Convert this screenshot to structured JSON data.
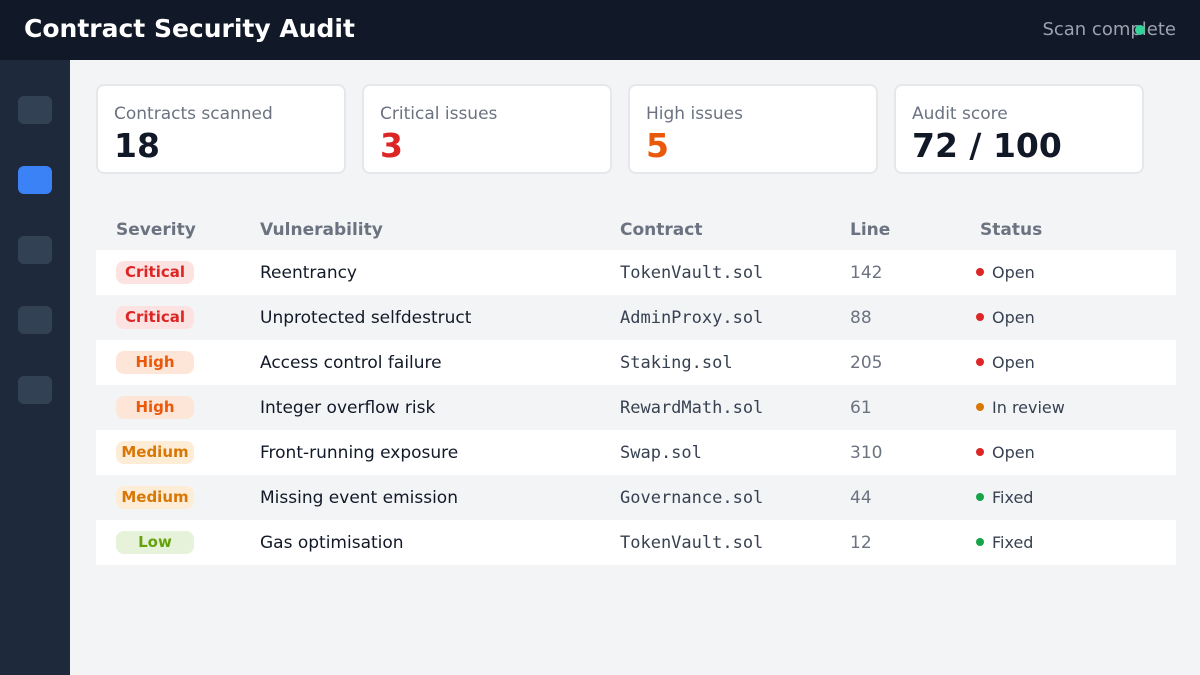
{
  "header": {
    "title": "Contract Security Audit",
    "scan_status": "Scan complete",
    "status_color": "#34d399"
  },
  "sidebar": {
    "items": [
      {
        "icon": "nav-icon-1",
        "active": false
      },
      {
        "icon": "nav-icon-2",
        "active": true
      },
      {
        "icon": "nav-icon-3",
        "active": false
      },
      {
        "icon": "nav-icon-4",
        "active": false
      },
      {
        "icon": "nav-icon-5",
        "active": false
      }
    ],
    "active_color": "#3b82f6"
  },
  "summary": [
    {
      "label": "Contracts scanned",
      "value": "18",
      "color": "#111827"
    },
    {
      "label": "Critical issues",
      "value": "3",
      "color": "#dc2626"
    },
    {
      "label": "High issues",
      "value": "5",
      "color": "#ea580c"
    },
    {
      "label": "Audit score",
      "value": "72 / 100",
      "color": "#111827"
    }
  ],
  "table": {
    "columns": [
      "Severity",
      "Vulnerability",
      "Contract",
      "Line",
      "Status"
    ],
    "rows": [
      {
        "severity": "Critical",
        "vulnerability": "Reentrancy",
        "contract": "TokenVault.sol",
        "line": "142",
        "status": "Open"
      },
      {
        "severity": "Critical",
        "vulnerability": "Unprotected selfdestruct",
        "contract": "AdminProxy.sol",
        "line": "88",
        "status": "Open"
      },
      {
        "severity": "High",
        "vulnerability": "Access control failure",
        "contract": "Staking.sol",
        "line": "205",
        "status": "Open"
      },
      {
        "severity": "High",
        "vulnerability": "Integer overflow risk",
        "contract": "RewardMath.sol",
        "line": "61",
        "status": "In review"
      },
      {
        "severity": "Medium",
        "vulnerability": "Front-running exposure",
        "contract": "Swap.sol",
        "line": "310",
        "status": "Open"
      },
      {
        "severity": "Medium",
        "vulnerability": "Missing event emission",
        "contract": "Governance.sol",
        "line": "44",
        "status": "Fixed"
      },
      {
        "severity": "Low",
        "vulnerability": "Gas optimisation",
        "contract": "TokenVault.sol",
        "line": "12",
        "status": "Fixed"
      }
    ]
  },
  "severity_colors": {
    "Critical": {
      "text": "#dc2626",
      "bg": "#fde2e2"
    },
    "High": {
      "text": "#ea580c",
      "bg": "#fde6d8"
    },
    "Medium": {
      "text": "#d97706",
      "bg": "#fdecd6"
    },
    "Low": {
      "text": "#65a30d",
      "bg": "#e6f2d9"
    }
  },
  "status_colors": {
    "Open": "#dc2626",
    "In review": "#d97706",
    "Fixed": "#16a34a"
  }
}
